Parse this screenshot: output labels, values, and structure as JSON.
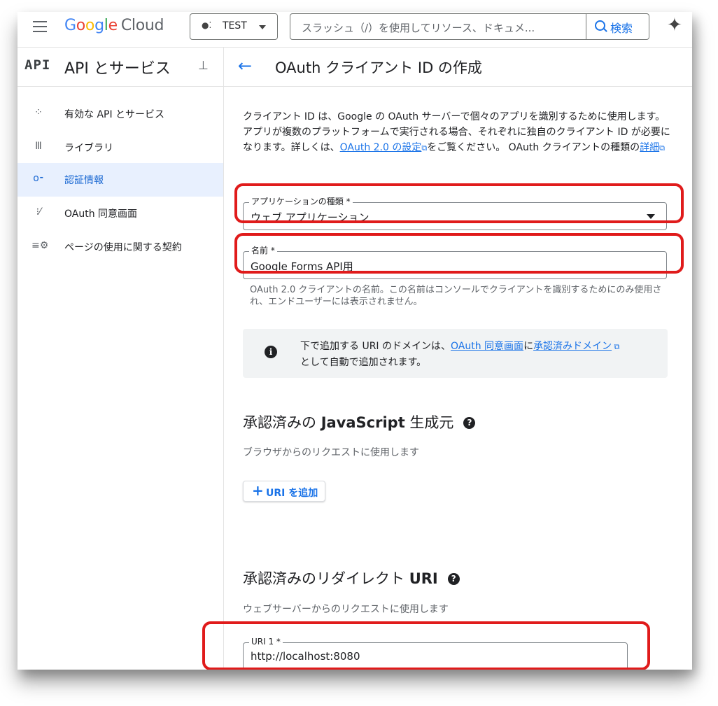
{
  "topbar": {
    "logo": {
      "g": "G",
      "o1": "o",
      "o2": "o",
      "g2": "g",
      "l": "l",
      "e": "e",
      "cloud": "Cloud"
    },
    "project": "TEST",
    "search_placeholder": "スラッシュ（/）を使用してリソース、ドキュメ...",
    "search_button": "検索"
  },
  "sidebar": {
    "icon": "API",
    "title": "API とサービス",
    "items": [
      {
        "label": "有効な API とサービス",
        "icon": "api-icon"
      },
      {
        "label": "ライブラリ",
        "icon": "library-icon"
      },
      {
        "label": "認証情報",
        "icon": "key-icon",
        "active": true
      },
      {
        "label": "OAuth 同意画面",
        "icon": "consent-icon"
      },
      {
        "label": "ページの使用に関する契約",
        "icon": "settings-list-icon"
      }
    ]
  },
  "main": {
    "title": "OAuth クライアント ID の作成",
    "intro": {
      "text1": "クライアント ID は、Google の OAuth サーバーで個々のアプリを識別するために使用します。アプリが複数のプラットフォームで実行される場合、それぞれに独自のクライアント ID が必要になります。詳しくは、",
      "link1": "OAuth 2.0 の設定",
      "text2": "をご覧ください。 OAuth クライアントの種類の",
      "link2": "詳細"
    },
    "app_type": {
      "label": "アプリケーションの種類 *",
      "value": "ウェブ アプリケーション"
    },
    "name": {
      "label": "名前 *",
      "value": "Google Forms API用"
    },
    "name_hint": "OAuth 2.0 クライアントの名前。この名前はコンソールでクライアントを識別するためにのみ使用され、エンドユーザーには表示されません。",
    "info": {
      "text1": "下で追加する URI のドメインは、",
      "link1": "OAuth 同意画面",
      "text2": "に",
      "link2": "承認済みドメイン",
      "text3": "として自動で追加されます。"
    },
    "js_origins": {
      "title_a": "承認済みの ",
      "title_b": "JavaScript",
      "title_c": " 生成元",
      "desc": "ブラウザからのリクエストに使用します",
      "add_button": "URI を追加"
    },
    "redirect": {
      "title_a": "承認済みのリダイレクト ",
      "title_b": "URI",
      "desc": "ウェブサーバーからのリクエストに使用します",
      "uri_label": "URI 1 *",
      "uri_value": "http://localhost:8080"
    }
  },
  "colors": {
    "accent": "#1a73e8",
    "highlight": "#e01b1b",
    "active_bg": "#e8f0fe"
  }
}
